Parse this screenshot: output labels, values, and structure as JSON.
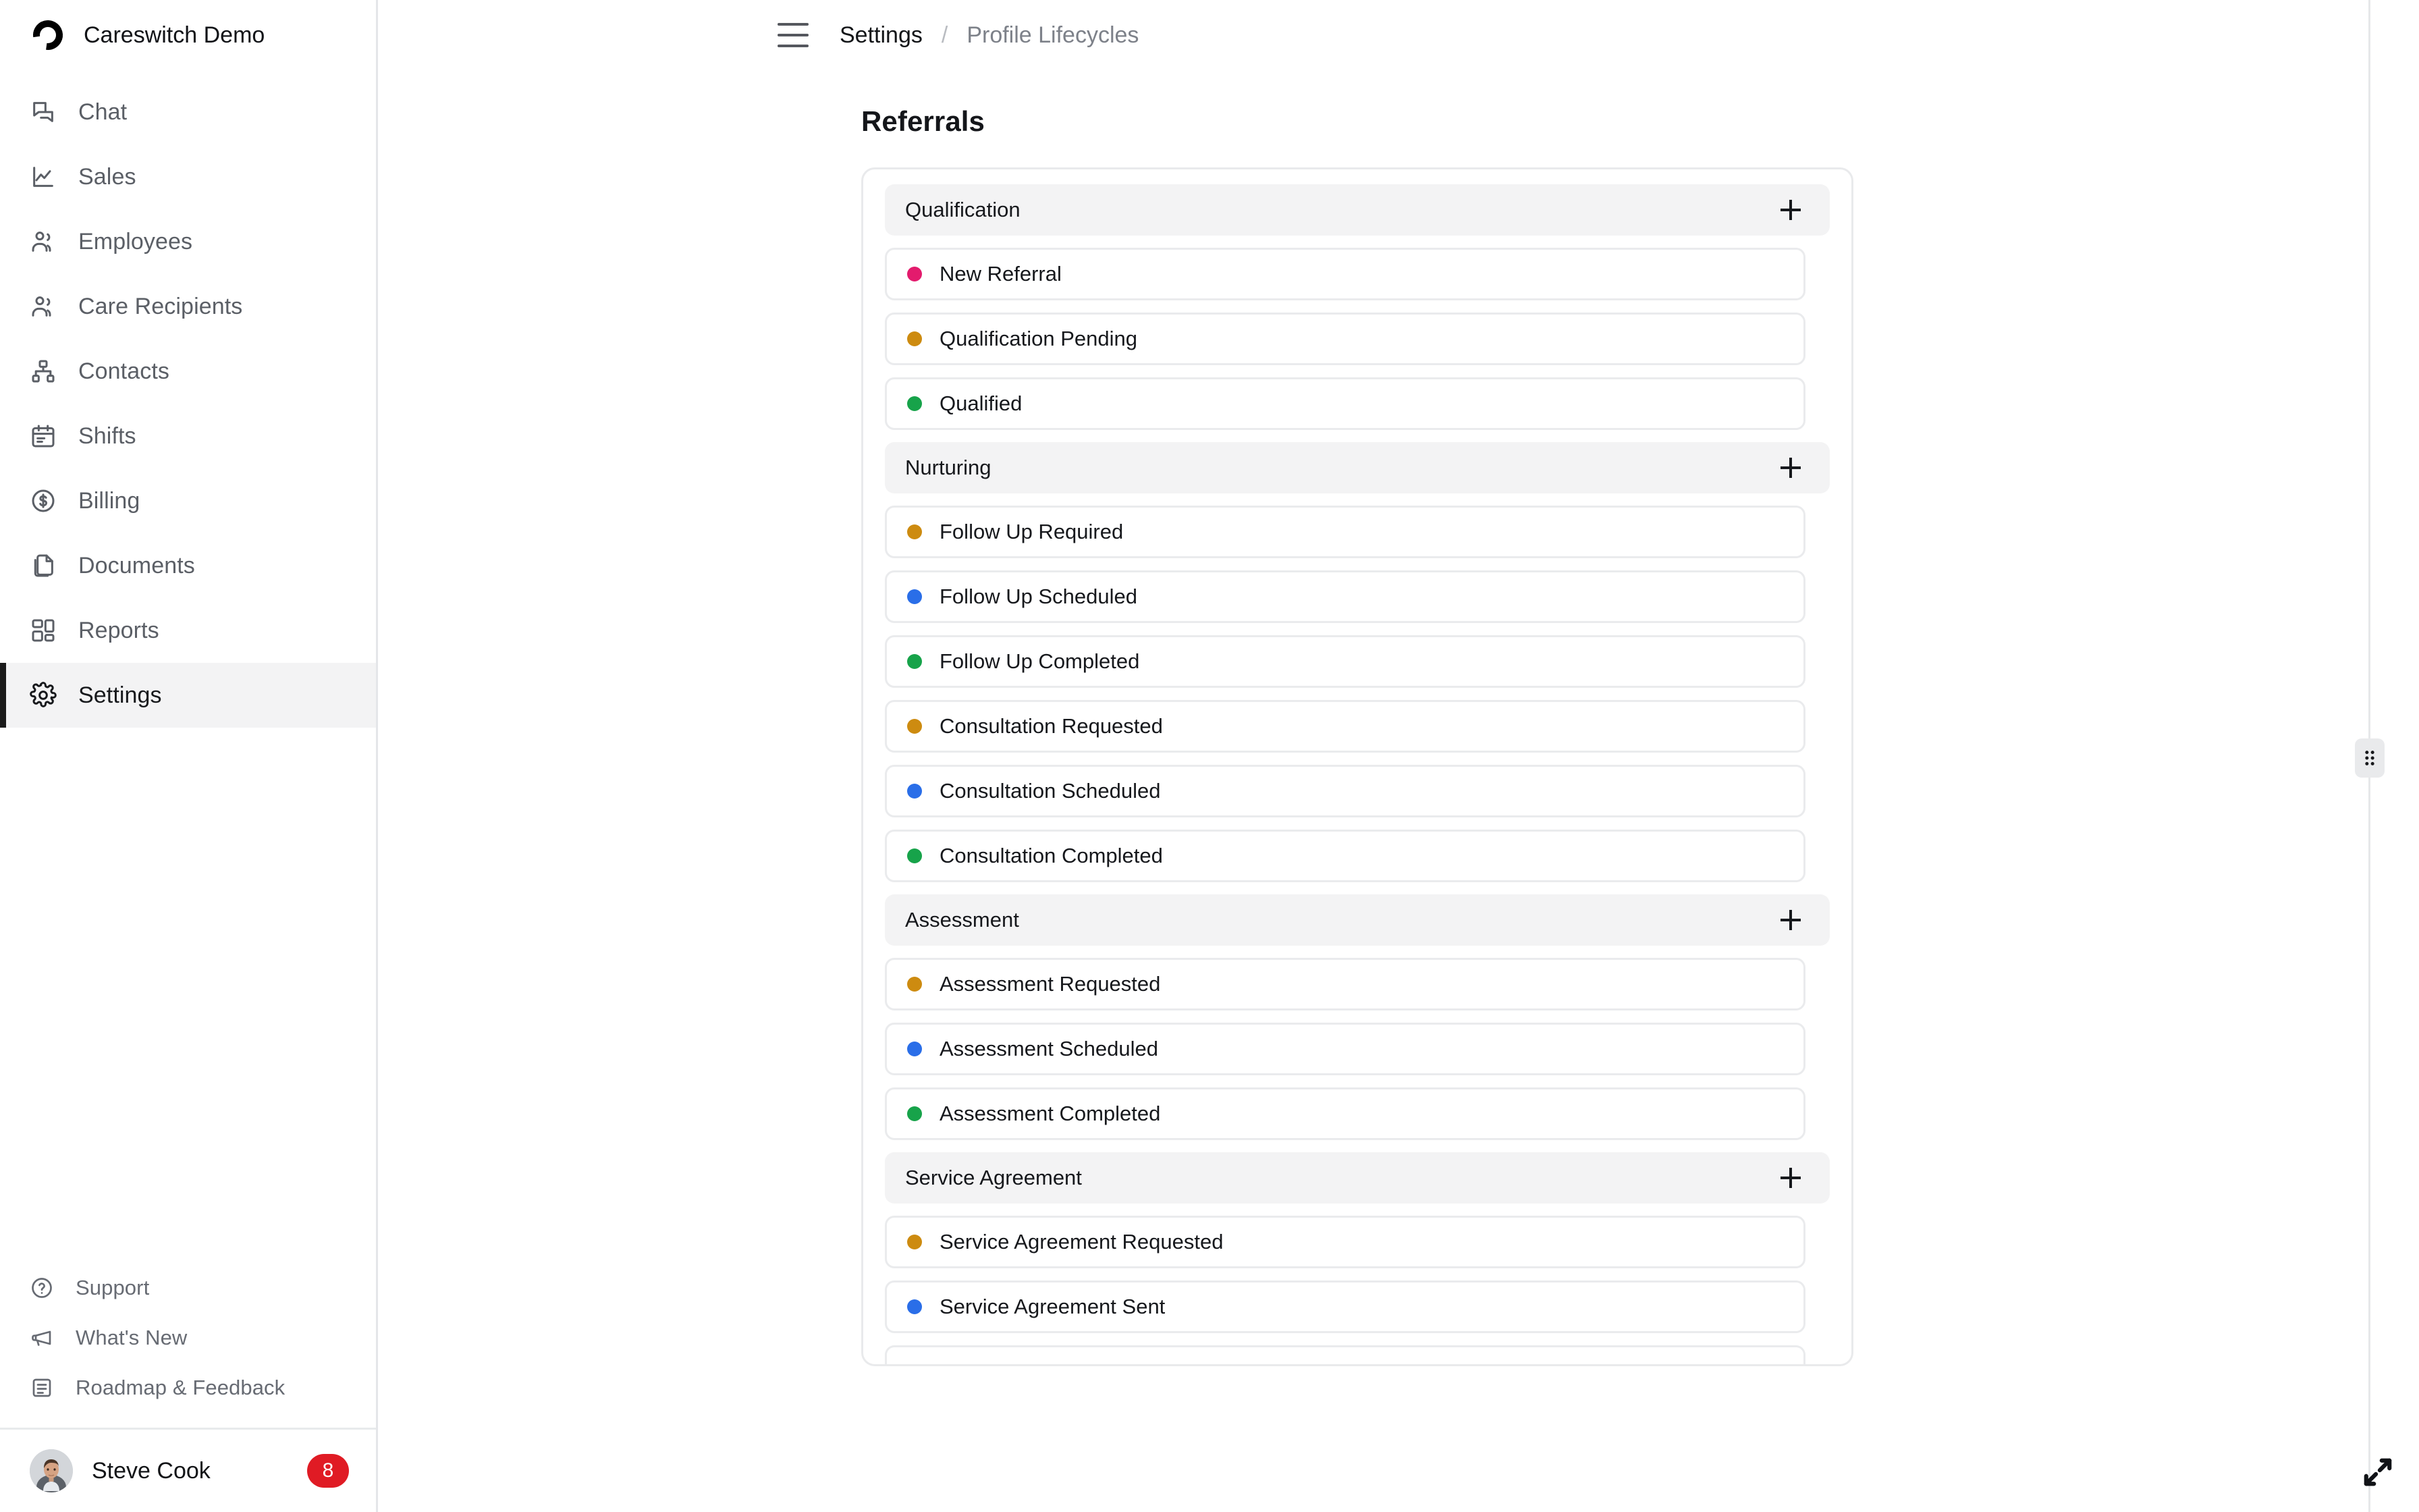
{
  "sidebar": {
    "brand": {
      "name": "Careswitch Demo",
      "logo_icon": "careswitch-ring-logo"
    },
    "items": [
      {
        "label": "Chat",
        "icon": "chat-icon",
        "active": false
      },
      {
        "label": "Sales",
        "icon": "line-chart-icon",
        "active": false
      },
      {
        "label": "Employees",
        "icon": "users-icon",
        "active": false
      },
      {
        "label": "Care Recipients",
        "icon": "users-icon",
        "active": false
      },
      {
        "label": "Contacts",
        "icon": "org-tree-icon",
        "active": false
      },
      {
        "label": "Shifts",
        "icon": "calendar-icon",
        "active": false
      },
      {
        "label": "Billing",
        "icon": "dollar-circle-icon",
        "active": false
      },
      {
        "label": "Documents",
        "icon": "documents-icon",
        "active": false
      },
      {
        "label": "Reports",
        "icon": "dashboard-grid-icon",
        "active": false
      },
      {
        "label": "Settings",
        "icon": "gear-icon",
        "active": true
      }
    ],
    "bottom_items": [
      {
        "label": "Support",
        "icon": "question-circle-icon"
      },
      {
        "label": "What's New",
        "icon": "megaphone-icon"
      },
      {
        "label": "Roadmap & Feedback",
        "icon": "roadmap-list-icon"
      }
    ],
    "user": {
      "name": "Steve Cook",
      "badge_count": "8",
      "badge_color": "#e01b24",
      "avatar_icon": "user-avatar-photo"
    }
  },
  "topbar": {
    "menu_icon": "hamburger-icon",
    "breadcrumb": {
      "parent": "Settings",
      "separator": "/",
      "current": "Profile Lifecycles"
    }
  },
  "main": {
    "title": "Referrals",
    "add_icon": "plus-icon",
    "groups": [
      {
        "name": "Qualification",
        "stages": [
          {
            "label": "New Referral",
            "color": "#e31b6d"
          },
          {
            "label": "Qualification Pending",
            "color": "#cd8b10"
          },
          {
            "label": "Qualified",
            "color": "#17a34a"
          }
        ]
      },
      {
        "name": "Nurturing",
        "stages": [
          {
            "label": "Follow Up Required",
            "color": "#cd8b10"
          },
          {
            "label": "Follow Up Scheduled",
            "color": "#2a6ee8"
          },
          {
            "label": "Follow Up Completed",
            "color": "#17a34a"
          },
          {
            "label": "Consultation Requested",
            "color": "#cd8b10"
          },
          {
            "label": "Consultation Scheduled",
            "color": "#2a6ee8"
          },
          {
            "label": "Consultation Completed",
            "color": "#17a34a"
          }
        ]
      },
      {
        "name": "Assessment",
        "stages": [
          {
            "label": "Assessment Requested",
            "color": "#cd8b10"
          },
          {
            "label": "Assessment Scheduled",
            "color": "#2a6ee8"
          },
          {
            "label": "Assessment Completed",
            "color": "#17a34a"
          }
        ]
      },
      {
        "name": "Service Agreement",
        "stages": [
          {
            "label": "Service Agreement Requested",
            "color": "#cd8b10"
          },
          {
            "label": "Service Agreement Sent",
            "color": "#2a6ee8"
          },
          {
            "label": "",
            "color": "#ffffff",
            "partial": true
          }
        ]
      }
    ]
  },
  "panel": {
    "resize_grip_icon": "drag-grip-icon",
    "expand_icon": "expand-diagonal-icon"
  }
}
